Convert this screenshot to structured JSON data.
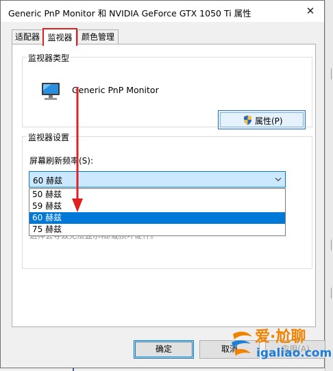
{
  "window": {
    "title": "Generic PnP Monitor 和 NVIDIA GeForce GTX 1050 Ti 属性",
    "close_icon": "close-icon"
  },
  "tabs": [
    {
      "label": "适配器",
      "active": false
    },
    {
      "label": "监视器",
      "active": true
    },
    {
      "label": "颜色管理",
      "active": false
    }
  ],
  "monitor_type": {
    "legend": "监视器类型",
    "monitor_name": "Generic PnP Monitor",
    "properties_button": "属性(P)",
    "icon": "monitor-icon",
    "button_icon": "shield-icon"
  },
  "monitor_settings": {
    "legend": "监视器设置",
    "refresh_label": "屏幕刷新频率(S):",
    "selected_value": "60 赫兹",
    "options": [
      "50 赫兹",
      "59 赫兹",
      "60 赫兹",
      "75 赫兹"
    ],
    "highlighted_option": "60 赫兹",
    "partially_hidden_text": "这样会导致无法显示和/或损坏硬件。"
  },
  "footer": {
    "ok": "确定",
    "cancel": "取消",
    "apply": "应用(A)"
  },
  "watermark": {
    "brand": "爱·尬聊",
    "url": "igaliao.com"
  },
  "colors": {
    "accent": "#0078d7",
    "highlight_border": "#e02020",
    "combo_fill": "#cce8ff"
  }
}
